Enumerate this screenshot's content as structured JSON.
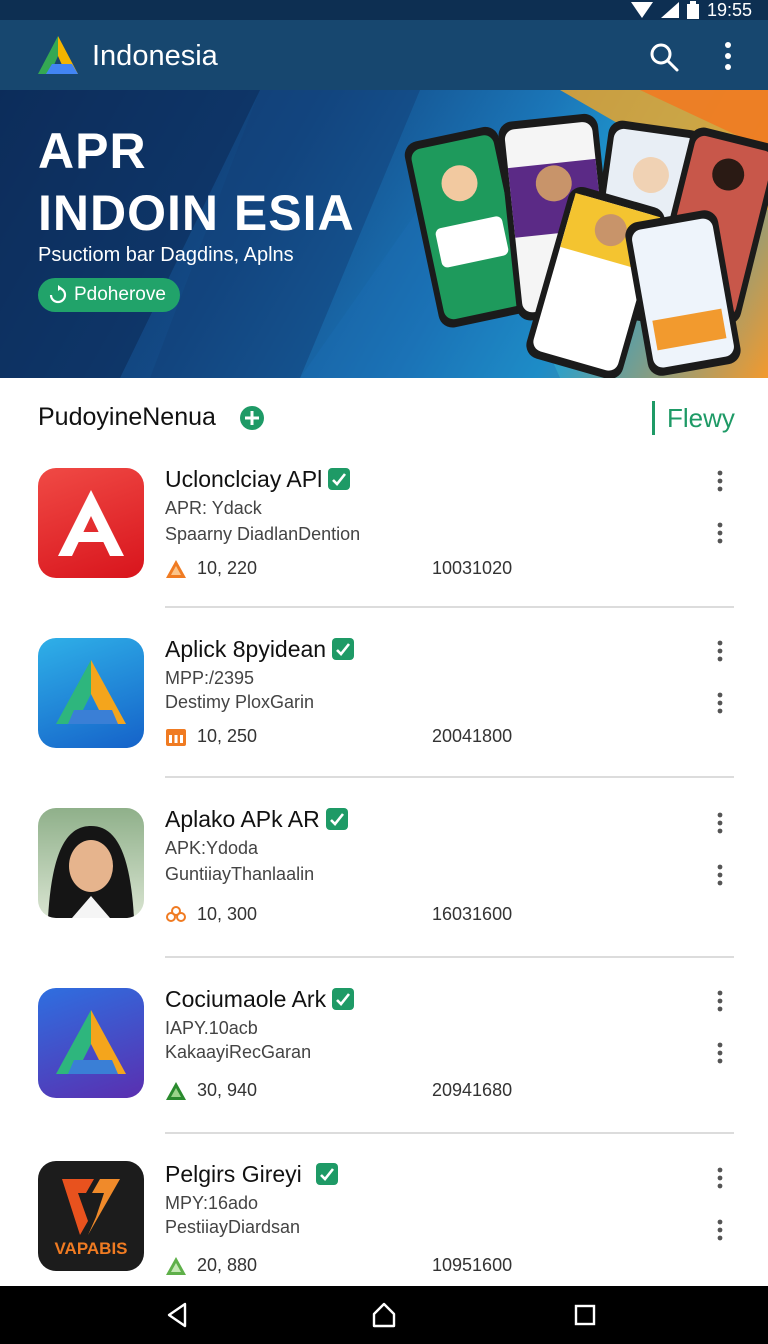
{
  "status_bar": {
    "time": "19:55"
  },
  "app_bar": {
    "title": "Indonesia",
    "icons": [
      "search-icon",
      "more-vert-icon"
    ]
  },
  "hero": {
    "title_line1": "APR",
    "title_line2": "INDOIN ESIA",
    "subtitle": "Psuctiom bar Dagdins, Aplns",
    "chip_label": "Pdoherove",
    "chip_icon": "refresh-icon"
  },
  "section": {
    "title": "PudoyineNenua",
    "link": "Flewy"
  },
  "apps": [
    {
      "name": "Uclonclciay APl",
      "sub1": "APR: Ydack",
      "sub2": "Spaarny DiadlanDention",
      "rating": "10, 220",
      "downloads": "10031020",
      "icon": "red-a-logo-icon",
      "rating_icon": "orange-triangle-icon"
    },
    {
      "name": "Aplick 8pyidean",
      "sub1": "MPP:/2395",
      "sub2": "Destimy PloxGarin",
      "rating": "10, 250",
      "downloads": "20041800",
      "icon": "blue-a-logo-icon",
      "rating_icon": "orange-store-icon"
    },
    {
      "name": "Aplako APk AR",
      "sub1": "APK:Ydoda",
      "sub2": "GuntiiayThanlaalin",
      "rating": "10, 300",
      "downloads": "16031600",
      "icon": "person-photo-icon",
      "rating_icon": "orange-flower-icon"
    },
    {
      "name": "Cociumaole Ark",
      "sub1": "IAPY.10acb",
      "sub2": "KakaayiRecGaran",
      "rating": "30, 940",
      "downloads": "20941680",
      "icon": "purple-a-logo-icon",
      "rating_icon": "green-triangle-icon"
    },
    {
      "name": "Pelgirs Gireyi",
      "sub1": "MPY:16ado",
      "sub2": "PestiiayDiardsan",
      "rating": "20, 880",
      "downloads": "10951600",
      "icon": "vapabis-logo-icon",
      "rating_icon": "green-triangle-icon"
    }
  ],
  "vapabis_text": "VAPABIS",
  "colors": {
    "app_bar": "#17476f",
    "status_bar": "#0d2f52",
    "accent_green": "#1e9a66"
  }
}
